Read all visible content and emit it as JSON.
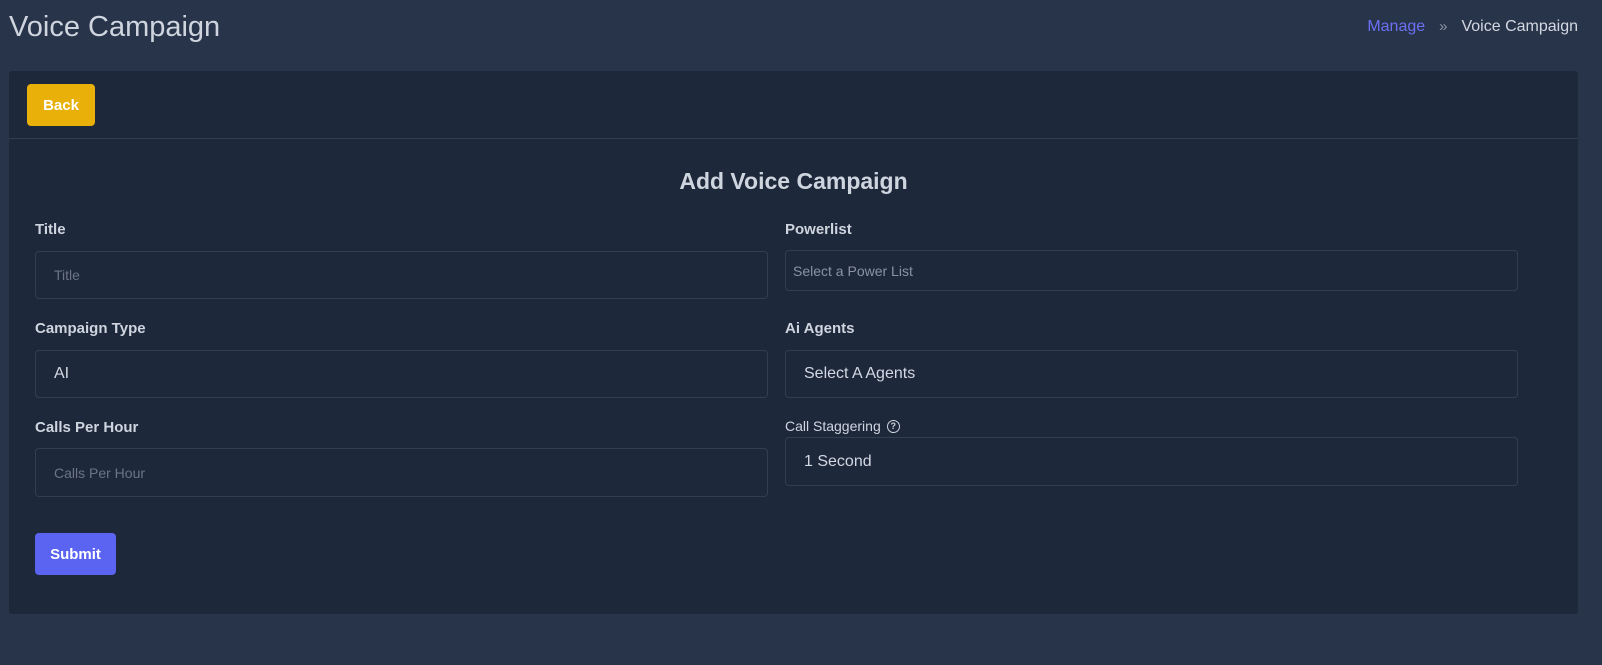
{
  "header": {
    "title": "Voice Campaign",
    "breadcrumb": {
      "link": "Manage",
      "separator": "»",
      "current": "Voice Campaign"
    }
  },
  "card": {
    "back_label": "Back",
    "form_title": "Add Voice Campaign",
    "fields": {
      "title": {
        "label": "Title",
        "placeholder": "Title",
        "value": ""
      },
      "powerlist": {
        "label": "Powerlist",
        "placeholder": "Select a Power List"
      },
      "campaign_type": {
        "label": "Campaign Type",
        "value": "AI"
      },
      "ai_agents": {
        "label": "Ai Agents",
        "value": "Select A Agents"
      },
      "calls_per_hour": {
        "label": "Calls Per Hour",
        "placeholder": "Calls Per Hour",
        "value": ""
      },
      "call_staggering": {
        "label": "Call Staggering",
        "help_icon": "question-circle-icon",
        "value": "1 Second"
      }
    },
    "submit_label": "Submit"
  },
  "colors": {
    "background": "#283449",
    "card": "#1e283b",
    "back_button": "#e8b009",
    "submit_button": "#5b63f1",
    "breadcrumb_link": "#6c6ff3"
  }
}
